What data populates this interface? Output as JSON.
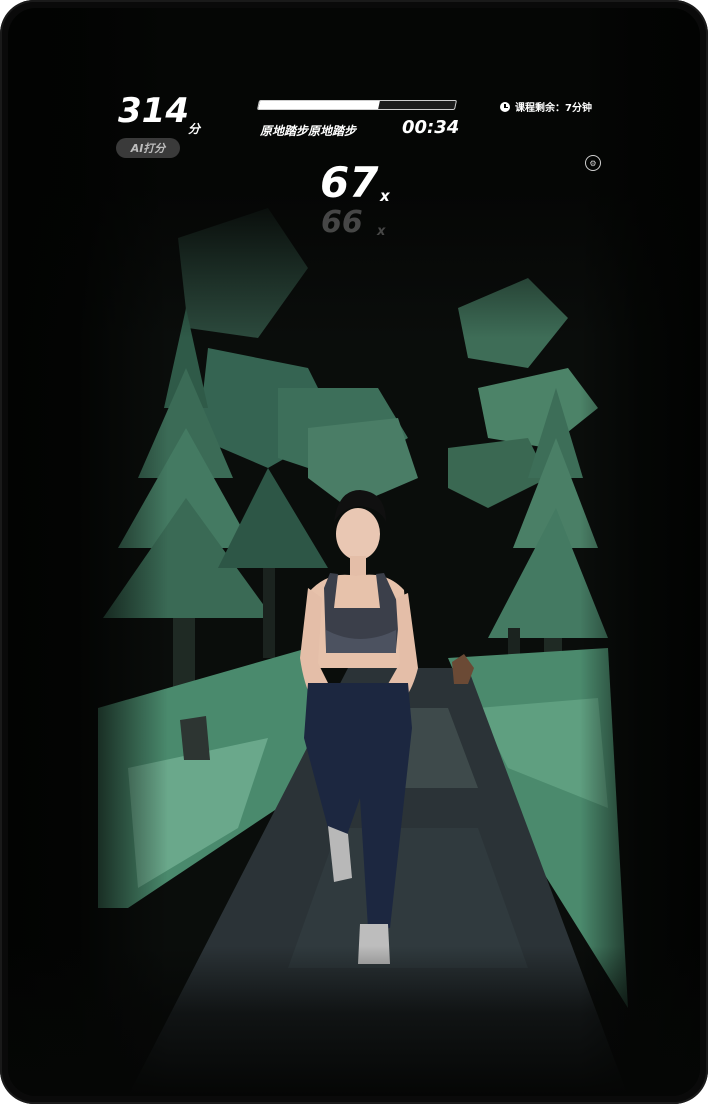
{
  "hud": {
    "score": "314",
    "score_unit": "分",
    "ai_badge": "AI打分",
    "exercise_progress": 0.61,
    "exercise_name": "原地踏步原地踏步",
    "exercise_time": "00:34",
    "remaining_label": "课程剩余：7分钟",
    "rep_count": "67",
    "rep_count_unit": "x",
    "prev_rep_count": "66",
    "prev_rep_count_unit": "x"
  },
  "icons": {
    "remaining": "clock-icon",
    "settings": "settings-icon"
  },
  "colors": {
    "background": "#050605",
    "foliage": "#4f8a6e",
    "path": "#2b3337",
    "progress_fill": "#ffffff"
  }
}
